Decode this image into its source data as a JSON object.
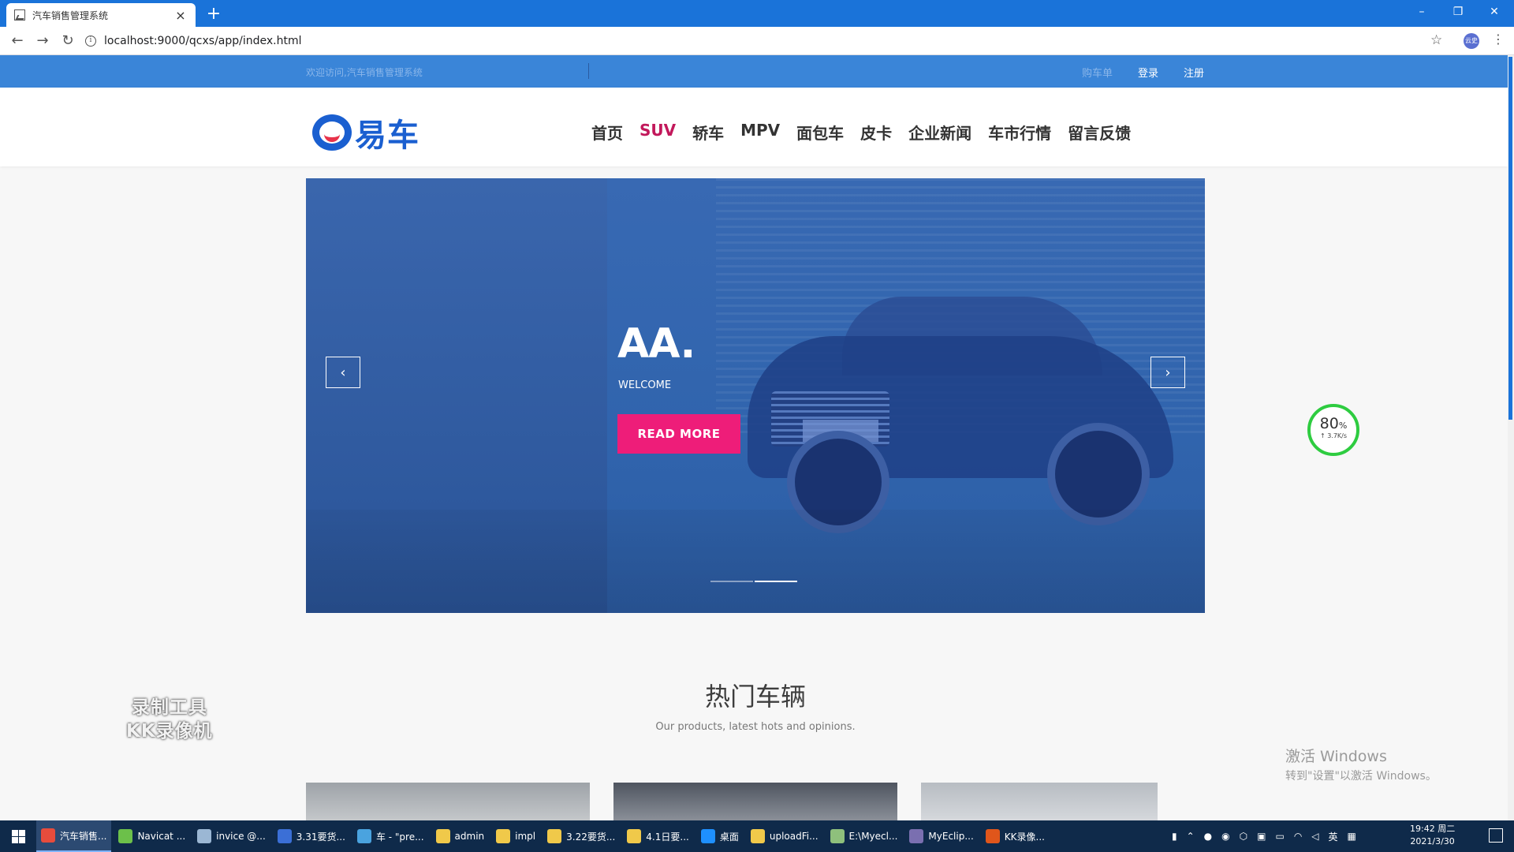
{
  "browser": {
    "tab_title": "汽车销售管理系统",
    "close_glyph": "×",
    "new_tab_glyph": "+",
    "url": "localhost:9000/qcxs/app/index.html",
    "profile_label": "云史",
    "win_min": "–",
    "win_restore": "❐",
    "win_close": "✕",
    "back": "←",
    "forward": "→",
    "reload": "↻",
    "star": "☆",
    "menu": "⋮",
    "info": "i"
  },
  "site": {
    "welcome": "欢迎访问,汽车销售管理系统",
    "top_links": {
      "cart": "购车单",
      "login": "登录",
      "register": "注册"
    },
    "logo_text": "易车",
    "nav": [
      "首页",
      "SUV",
      "轿车",
      "MPV",
      "面包车",
      "皮卡",
      "企业新闻",
      "车市行情",
      "留言反馈"
    ],
    "active_nav_index": 1,
    "hero": {
      "title": "AA.",
      "subtitle": "WELCOME",
      "button": "READ MORE",
      "prev": "‹",
      "next": "›",
      "slide_count": 2,
      "active_slide_index": 1
    },
    "hot": {
      "title": "热门车辆",
      "subtitle": "Our products, latest hots and opinions."
    },
    "colors": {
      "brand_blue": "#1a5fd0",
      "accent_pink": "#ee1d79",
      "active_nav": "#c2185b",
      "topbar": "#3a85d8"
    }
  },
  "overlays": {
    "speed_pct": "80",
    "speed_unit": "%",
    "speed_rate": "↑ 3.7K/s",
    "recorder_line1": "录制工具",
    "recorder_line2": "KK录像机",
    "activate_line1": "激活 Windows",
    "activate_line2": "转到\"设置\"以激活 Windows。"
  },
  "taskbar": {
    "tasks": [
      {
        "label": "汽车销售...",
        "icon": "chrome-icon",
        "color": "#e74c3c",
        "active": true
      },
      {
        "label": "Navicat ...",
        "icon": "navicat-icon",
        "color": "#6cc04a",
        "active": false
      },
      {
        "label": "invice @...",
        "icon": "window-icon",
        "color": "#9bb7d4",
        "active": false
      },
      {
        "label": "3.31要货...",
        "icon": "doc-icon",
        "color": "#3b6fd6",
        "active": false
      },
      {
        "label": "车 - \"pre...",
        "icon": "file-icon",
        "color": "#4aa3df",
        "active": false
      },
      {
        "label": "admin",
        "icon": "folder-icon",
        "color": "#f0c94a",
        "active": false
      },
      {
        "label": "impl",
        "icon": "folder-icon",
        "color": "#f0c94a",
        "active": false
      },
      {
        "label": "3.22要货...",
        "icon": "folder-icon",
        "color": "#f0c94a",
        "active": false
      },
      {
        "label": "4.1日要...",
        "icon": "folder-icon",
        "color": "#f0c94a",
        "active": false
      },
      {
        "label": "桌面",
        "icon": "desktop-icon",
        "color": "#1e90ff",
        "active": false
      },
      {
        "label": "uploadFi...",
        "icon": "folder-icon",
        "color": "#f0c94a",
        "active": false
      },
      {
        "label": "E:\\Myecl...",
        "icon": "terminal-icon",
        "color": "#8ec07c",
        "active": false
      },
      {
        "label": "MyEclip...",
        "icon": "eclipse-icon",
        "color": "#7a6fb0",
        "active": false
      },
      {
        "label": "KK录像...",
        "icon": "kk-icon",
        "color": "#e0561b",
        "active": false
      }
    ],
    "tray_lang": "英",
    "clock_time": "19:42 周二",
    "clock_date": "2021/3/30"
  }
}
